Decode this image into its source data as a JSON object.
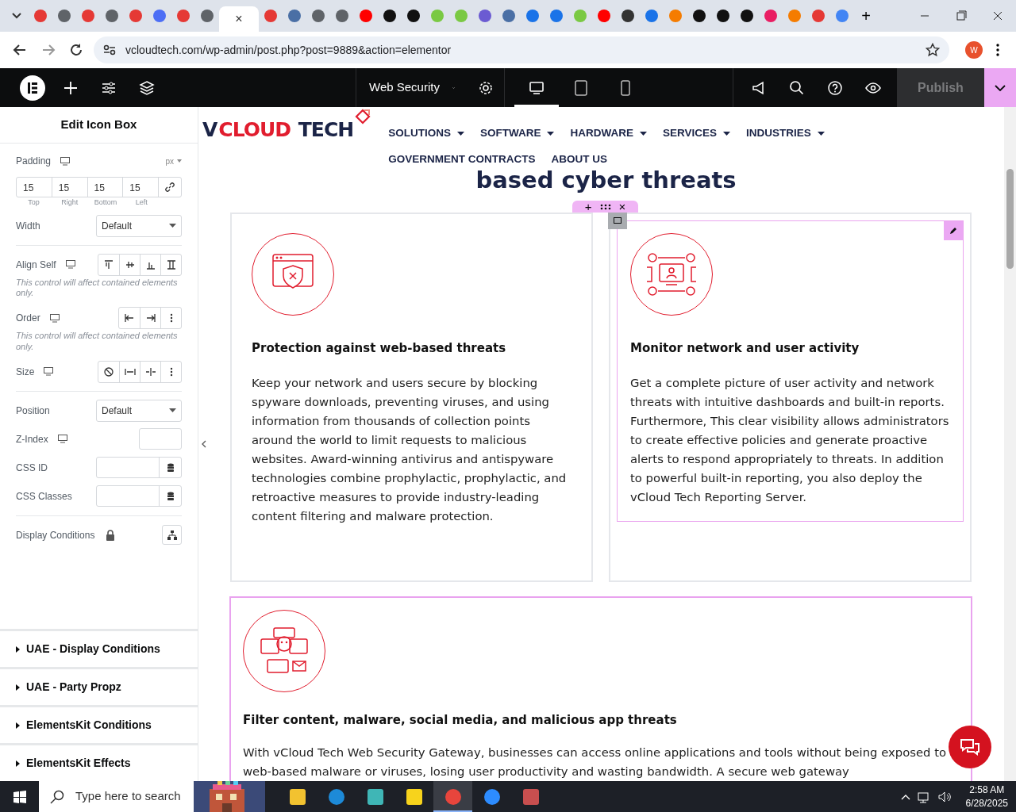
{
  "browser": {
    "tabs": [
      {
        "selected": false
      },
      {
        "selected": false
      },
      {
        "selected": false
      },
      {
        "selected": false
      },
      {
        "selected": false
      },
      {
        "selected": false
      },
      {
        "selected": false
      },
      {
        "selected": false
      },
      {
        "selected": true,
        "close": "×"
      },
      {
        "selected": false
      },
      {
        "selected": false
      },
      {
        "selected": false
      },
      {
        "selected": false
      },
      {
        "selected": false
      },
      {
        "selected": false
      },
      {
        "selected": false
      },
      {
        "selected": false
      },
      {
        "selected": false
      },
      {
        "selected": false
      },
      {
        "selected": false
      },
      {
        "selected": false
      },
      {
        "selected": false
      },
      {
        "selected": false
      },
      {
        "selected": false
      },
      {
        "selected": false
      },
      {
        "selected": false
      },
      {
        "selected": false
      },
      {
        "selected": false
      },
      {
        "selected": false
      },
      {
        "selected": false
      },
      {
        "selected": false
      },
      {
        "selected": false
      },
      {
        "selected": false
      },
      {
        "selected": false
      }
    ],
    "new_tab": "+",
    "address": "vcloudtech.com/wp-admin/post.php?post=9889&action=elementor",
    "profile": "W"
  },
  "editor_bar": {
    "page_title": "Web Security",
    "devices": [
      {
        "selected": true
      },
      {
        "selected": false
      },
      {
        "selected": false
      }
    ],
    "publish": "Publish",
    "publish_disabled": true
  },
  "panel": {
    "title": "Edit Icon Box",
    "controls": [
      {
        "kind": "padding",
        "label": "Padding",
        "unit": "px",
        "values": [
          {
            "value": "15",
            "caption": "Top"
          },
          {
            "value": "15",
            "caption": "Right"
          },
          {
            "value": "15",
            "caption": "Bottom"
          },
          {
            "value": "15",
            "caption": "Left"
          }
        ]
      },
      {
        "kind": "select",
        "label": "Width",
        "value": "Default",
        "divider": true
      },
      {
        "kind": "buttons",
        "label": "Align Self"
      },
      {
        "kind": "note",
        "text": "This control will affect contained elements only."
      },
      {
        "kind": "buttons",
        "label": "Order"
      },
      {
        "kind": "note",
        "text": "This control will affect contained elements only."
      },
      {
        "kind": "buttons",
        "label": "Size",
        "divider": true
      },
      {
        "kind": "select",
        "label": "Position",
        "value": "Default"
      },
      {
        "kind": "input",
        "label": "Z-Index"
      },
      {
        "kind": "dynamic",
        "label": "CSS ID"
      },
      {
        "kind": "dynamic",
        "label": "CSS Classes",
        "divider": true
      },
      {
        "kind": "conditions",
        "label": "Display Conditions"
      }
    ],
    "sections": [
      "UAE - Display Conditions",
      "UAE - Party Propz",
      "ElementsKit Conditions",
      "ElementsKit Effects"
    ]
  },
  "site": {
    "logo": [
      {
        "text": "V",
        "color": "#1b2447"
      },
      {
        "text": "CLOUD",
        "color": "#e11d2e"
      },
      {
        "text": " TECH",
        "color": "#1b2447"
      }
    ],
    "nav": [
      {
        "label": "SOLUTIONS",
        "dropdown": true
      },
      {
        "label": "SOFTWARE",
        "dropdown": true
      },
      {
        "label": "HARDWARE",
        "dropdown": true
      },
      {
        "label": "SERVICES",
        "dropdown": true
      },
      {
        "label": "INDUSTRIES",
        "dropdown": true
      },
      {
        "label": "GOVERNMENT CONTRACTS",
        "dropdown": false
      },
      {
        "label": "ABOUT US",
        "dropdown": false
      }
    ],
    "heading": "based cyber threats",
    "section_handle": {
      "add": "+",
      "close": "×"
    },
    "cards": [
      {
        "title": "Protection against web-based threats",
        "text": "Keep your network and users secure by blocking spyware downloads, preventing viruses, and using information from thousands of collection points around the world to limit requests to malicious websites. Award-winning antivirus and antispyware technologies combine prophylactic, prophylactic, and retroactive measures to provide industry-leading content filtering and malware protection.",
        "selected": false,
        "outlined": false
      },
      {
        "title": "Monitor network and user activity",
        "text": "Get a complete picture of user activity and network threats with intuitive dashboards and built-in reports. Furthermore, This clear visibility allows administrators to create effective policies and generate proactive alerts to respond appropriately to threats. In addition to powerful built-in reporting, you also deploy the vCloud Tech Reporting Server.",
        "selected": true,
        "outlined": false
      },
      {
        "title": "Filter content, malware, social media, and malicious app threats",
        "text": "With vCloud Tech Web Security Gateway, businesses can access online applications and tools without being exposed to web-based malware or viruses, losing user productivity and wasting bandwidth. A secure web gateway",
        "selected": false,
        "outlined": true
      }
    ]
  },
  "taskbar": {
    "search_placeholder": "Type here to search",
    "time": "2:58 AM",
    "date": "6/28/2025"
  }
}
